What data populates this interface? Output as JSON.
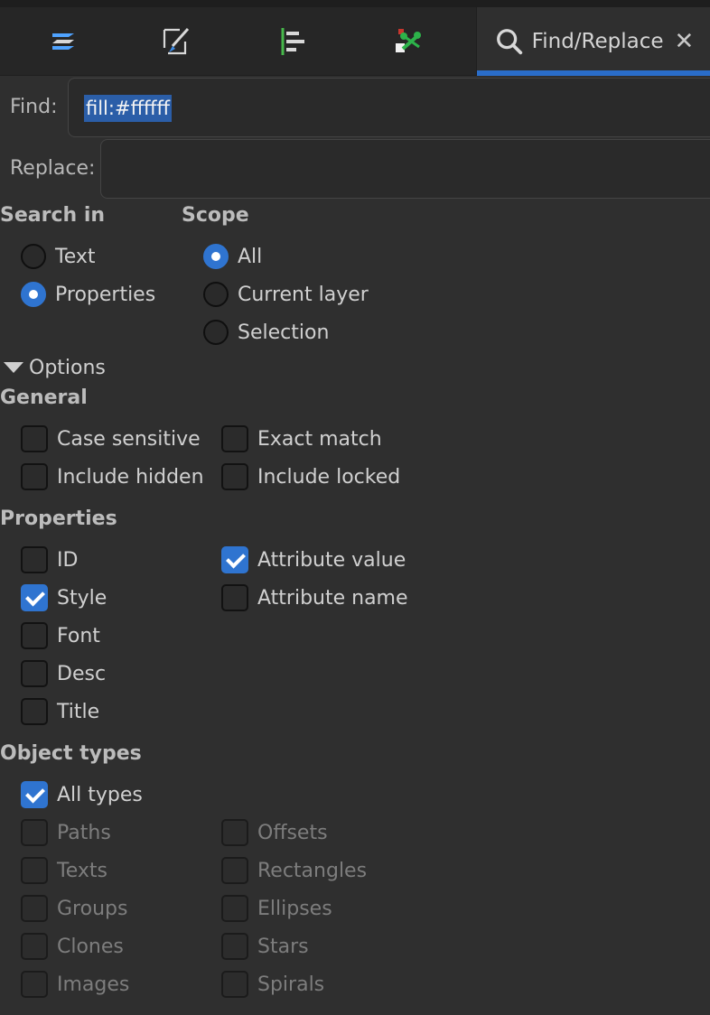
{
  "tabs": [
    {
      "icon": "layers-icon"
    },
    {
      "icon": "fill-stroke-icon"
    },
    {
      "icon": "align-distribute-icon"
    },
    {
      "icon": "preferences-tools-icon"
    },
    {
      "icon": "search-icon",
      "label": "Find/Replace",
      "close_icon": "close-icon"
    }
  ],
  "find": {
    "label": "Find:",
    "value": "fill:#ffffff"
  },
  "replace": {
    "label": "Replace:",
    "value": ""
  },
  "search_in": {
    "title": "Search in",
    "options": [
      {
        "label": "Text",
        "selected": false
      },
      {
        "label": "Properties",
        "selected": true
      }
    ]
  },
  "scope": {
    "title": "Scope",
    "options": [
      {
        "label": "All",
        "selected": true
      },
      {
        "label": "Current layer",
        "selected": false
      },
      {
        "label": "Selection",
        "selected": false
      }
    ]
  },
  "options_toggle": "Options",
  "general": {
    "title": "General",
    "items": [
      {
        "label": "Case sensitive",
        "checked": false
      },
      {
        "label": "Exact match",
        "checked": false
      },
      {
        "label": "Include hidden",
        "checked": false
      },
      {
        "label": "Include locked",
        "checked": false
      }
    ]
  },
  "properties": {
    "title": "Properties",
    "items": [
      {
        "label": "ID",
        "checked": false
      },
      {
        "label": "Attribute value",
        "checked": true
      },
      {
        "label": "Style",
        "checked": true
      },
      {
        "label": "Attribute name",
        "checked": false
      },
      {
        "label": "Font",
        "checked": false
      },
      {
        "label": "Desc",
        "checked": false
      },
      {
        "label": "Title",
        "checked": false
      }
    ]
  },
  "object_types": {
    "title": "Object types",
    "all_types": {
      "label": "All types",
      "checked": true
    },
    "items": [
      {
        "label": "Paths",
        "enabled": false
      },
      {
        "label": "Offsets",
        "enabled": false
      },
      {
        "label": "Texts",
        "enabled": false
      },
      {
        "label": "Rectangles",
        "enabled": false
      },
      {
        "label": "Groups",
        "enabled": false
      },
      {
        "label": "Ellipses",
        "enabled": false
      },
      {
        "label": "Clones",
        "enabled": false
      },
      {
        "label": "Stars",
        "enabled": false
      },
      {
        "label": "Images",
        "enabled": false
      },
      {
        "label": "Spirals",
        "enabled": false
      }
    ]
  },
  "colors": {
    "accent": "#2f74d0",
    "background": "#2f2f2f",
    "tabbar": "#262626"
  }
}
